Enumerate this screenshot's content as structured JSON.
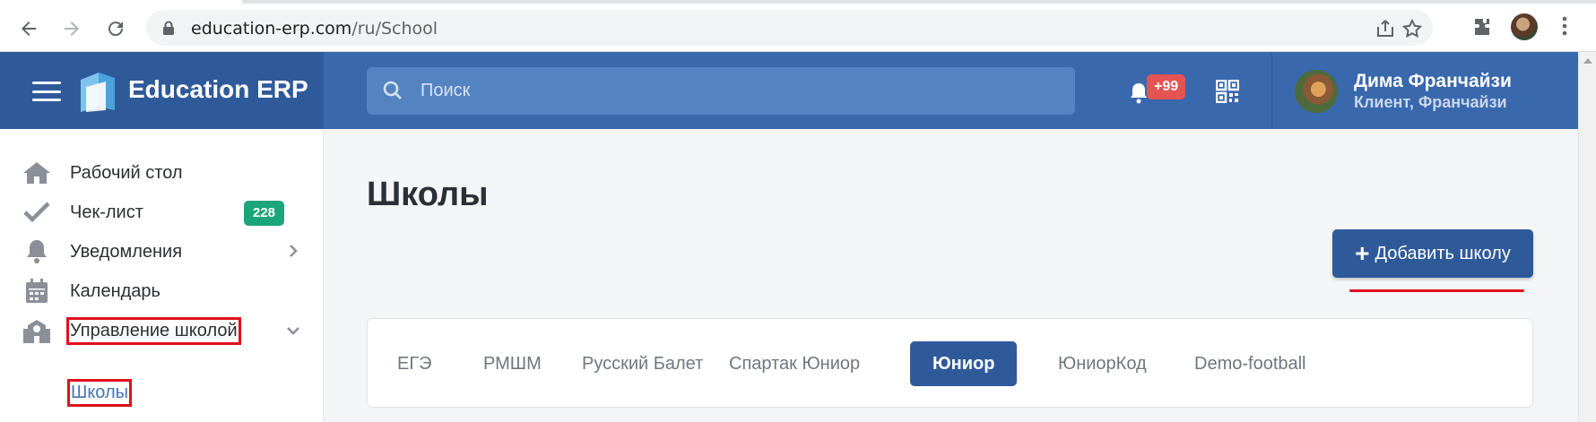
{
  "browser": {
    "url_host": "education-erp.com",
    "url_path": "/ru/School"
  },
  "header": {
    "app_title": "Education ERP",
    "search_placeholder": "Поиск",
    "notifications_badge": "+99",
    "user": {
      "name": "Дима Франчайзи",
      "role": "Клиент, Франчайзи"
    }
  },
  "sidebar": {
    "items": [
      {
        "label": "Рабочий стол",
        "icon": "home-icon"
      },
      {
        "label": "Чек-лист",
        "icon": "check-icon",
        "badge": "228"
      },
      {
        "label": "Уведомления",
        "icon": "bell-icon"
      },
      {
        "label": "Календарь",
        "icon": "calendar-icon"
      },
      {
        "label": "Управление школой",
        "icon": "school-icon"
      }
    ],
    "sub_item": "Школы"
  },
  "main": {
    "title": "Школы",
    "add_button": "Добавить школу",
    "tabs": [
      "ЕГЭ",
      "РМШМ",
      "Русский Балет",
      "Спартак Юниор",
      "Юниор",
      "ЮниорКод",
      "Demo-football"
    ],
    "active_tab": "Юниор"
  },
  "colors": {
    "header": "#3a68ad",
    "primary": "#2f5a9a",
    "badge_red": "#e55353",
    "badge_green": "#1aa678",
    "highlight": "#e0101c"
  }
}
